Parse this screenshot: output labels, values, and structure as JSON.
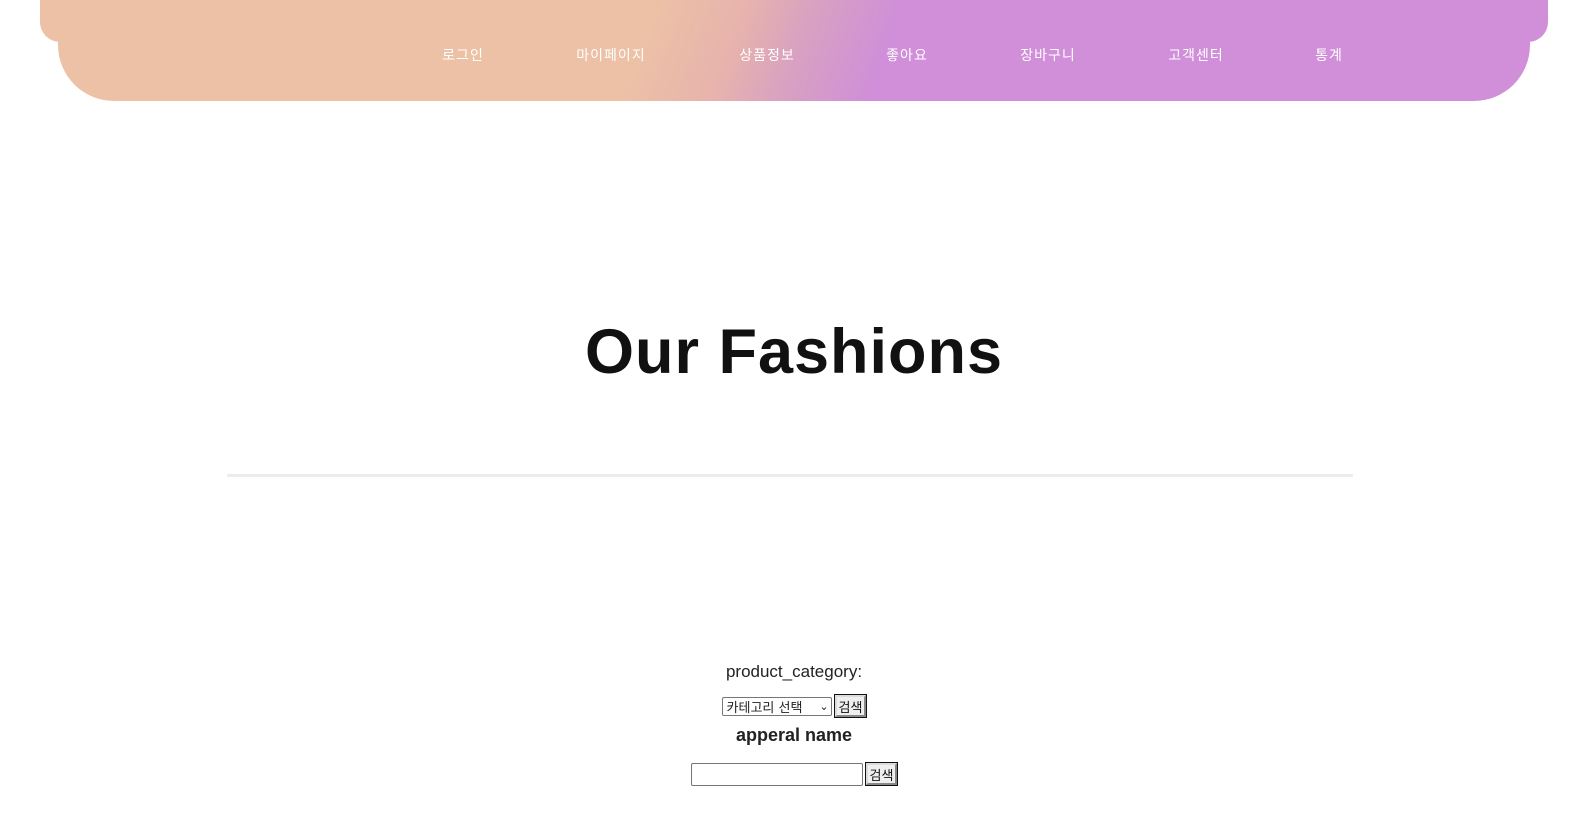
{
  "nav": {
    "items": [
      {
        "label": "로그인"
      },
      {
        "label": "마이페이지"
      },
      {
        "label": "상품정보"
      },
      {
        "label": "좋아요"
      },
      {
        "label": "장바구니"
      },
      {
        "label": "고객센터"
      },
      {
        "label": "통계"
      }
    ]
  },
  "colors": {
    "header_start": "#ecc1a6",
    "header_end": "#d08fd8",
    "title": "#111111",
    "divider": "#ececec"
  },
  "main": {
    "title": "Our Fashions"
  },
  "search": {
    "category_label": "product_category:",
    "category_select_value": "카테고리 선택",
    "category_search_button": "검색",
    "name_label": "apperal name",
    "name_input_value": "",
    "name_search_button": "검색"
  }
}
